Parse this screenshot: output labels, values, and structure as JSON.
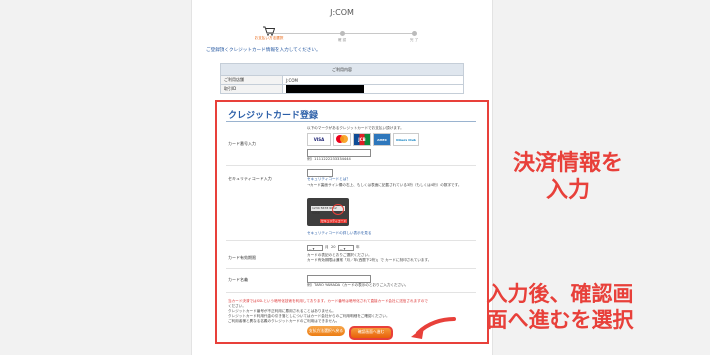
{
  "site": {
    "title": "J:COM"
  },
  "steps": [
    {
      "label": "お支払い方法選択",
      "active": true
    },
    {
      "label": "確 認",
      "active": false
    },
    {
      "label": "完 了",
      "active": false
    }
  ],
  "lead_text": "ご登録頂くクレジットカード情報を入力してください。",
  "info_table": {
    "header": "ご利用内容",
    "rows": [
      {
        "key": "ご利用店舗",
        "value": "J:COM"
      },
      {
        "key": "取引ID",
        "value": ""
      }
    ]
  },
  "card_form": {
    "title": "クレジットカード登録",
    "card_number": {
      "label": "カード番号入力",
      "brand_note": "以下のマークがあるクレジットカードでお支払い頂けます。",
      "brands": [
        "VISA",
        "MasterCard",
        "JCB",
        "AMEX",
        "Diners Club"
      ],
      "example": "例）1111222233334444"
    },
    "security_code": {
      "label": "セキュリティコード入力",
      "help_link": "セキュリティコードとは？",
      "note": "→カード裏面サイン欄の右上、もしくは表面に記載されている3桁（もしくは4桁）の数字です。",
      "card_strip_text": "1234 5678 9012 3456",
      "card_caption": "セキュリティコード",
      "detail_link": "セキュリティコードの詳しい表示を見る"
    },
    "expiry": {
      "label": "カード有効期限",
      "month_value": "--",
      "month_unit": "月",
      "year_prefix": "20",
      "year_value": "--",
      "year_unit": "年",
      "note1": "カードの表記のとおりご選択ください。",
      "note2": "カード有効期限は通常「月／年(西暦下2桁)」で カードに刻印されています。"
    },
    "holder": {
      "label": "カード名義",
      "example": "例）TARO YAMADA（カードの表示のとおりご入力ください。"
    },
    "notes": [
      "当カード決済ではSSLという暗号化技術を利用しております。カード番号は暗号化されて直接カード会社に送信されますので",
      "ください。",
      "クレジットカード番号が不正利用に悪用されることはありません。",
      "クレジットカード利用代金の引き落としについてはカード会社からのご利用明細をご確認ください。",
      "ご利用者様と異なる名義のクレジットカードのご利用はできません。"
    ],
    "back_button": "支払方法選択へ戻る",
    "next_button": "確認画面へ進む"
  },
  "annotations": {
    "top": "決済情報を\n入力",
    "bottom": "入力後、確認画\n面へ進むを選択"
  },
  "colors": {
    "accent": "#e8403a",
    "brand_blue": "#2a5ea8",
    "button_orange": "#ec7d14"
  }
}
